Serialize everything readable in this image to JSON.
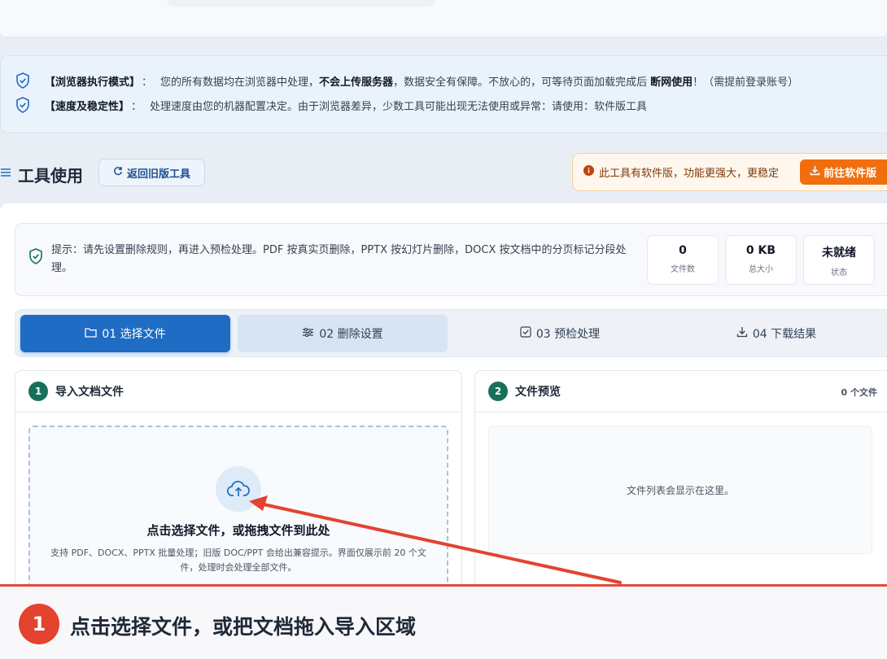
{
  "notice": {
    "line1": {
      "tag": "【浏览器执行模式】",
      "sep": "：",
      "part1": "您的所有数据均在浏览器中处理，",
      "bold1": "不会上传服务器",
      "part2": "，数据安全有保障。不放心的，可等待页面加载完成后",
      "bold2": "断网使用",
      "part3": "！（需提前登录账号）"
    },
    "line2": {
      "tag": "【速度及稳定性】",
      "sep": "：",
      "text": "处理速度由您的机器配置决定。由于浏览器差异，少数工具可能出现无法使用或异常：请使用：软件版工具"
    }
  },
  "header": {
    "title": "工具使用",
    "old_button": "返回旧版工具",
    "software_notice": "此工具有软件版，功能更强大，更稳定",
    "software_button": "前往软件版"
  },
  "tip": {
    "text": "提示：请先设置删除规则，再进入预检处理。PDF 按真实页删除，PPTX 按幻灯片删除，DOCX 按文档中的分页标记分段处理。",
    "stats": [
      {
        "value": "0",
        "label": "文件数"
      },
      {
        "value": "0 KB",
        "label": "总大小"
      },
      {
        "value": "未就绪",
        "label": "状态"
      }
    ]
  },
  "steps": [
    {
      "label": "01 选择文件",
      "icon": "folder-icon"
    },
    {
      "label": "02 删除设置",
      "icon": "sliders-icon"
    },
    {
      "label": "03 预检处理",
      "icon": "checkbox-icon"
    },
    {
      "label": "04 下载结果",
      "icon": "download-icon"
    }
  ],
  "import_card": {
    "number": "1",
    "title": "导入文档文件",
    "drop_title": "点击选择文件，或拖拽文件到此处",
    "drop_hint": "支持 PDF、DOCX、PPTX 批量处理；旧版 DOC/PPT 会给出兼容提示。界面仅展示前 20 个文件，处理时会处理全部文件。"
  },
  "preview_card": {
    "number": "2",
    "title": "文件预览",
    "count": "0 个文件",
    "empty_text": "文件列表会显示在这里。"
  },
  "caption": {
    "number": "1",
    "text": "点击选择文件，或把文档拖入导入区域"
  },
  "colors": {
    "primary": "#1e6cc4",
    "accent_orange": "#f06e0f",
    "step_badge": "#17705a",
    "annotation_red": "#e4432f"
  }
}
